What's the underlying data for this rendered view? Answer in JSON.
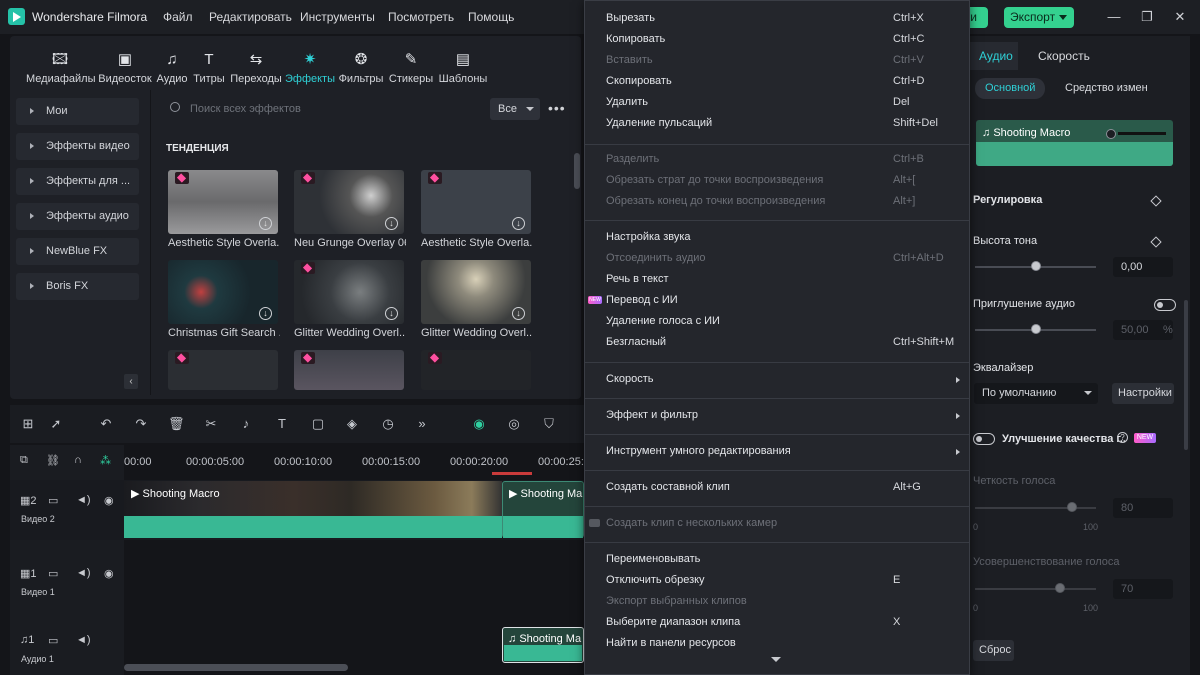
{
  "app": {
    "title": "Wondershare Filmora"
  },
  "menubar": [
    "Файл",
    "Редактировать",
    "Инструменты",
    "Посмотреть",
    "Помощь"
  ],
  "header": {
    "export_partial": "ити",
    "export_label": "Экспорт",
    "accent": "#34d18f"
  },
  "toolbar": [
    "Медиафайлы",
    "Видеосток",
    "Аудио",
    "Титры",
    "Переходы",
    "Эффекты",
    "Фильтры",
    "Стикеры",
    "Шаблоны"
  ],
  "categories": [
    "Мои",
    "Эффекты видео",
    "Эффекты для ...",
    "Эффекты аудио",
    "NewBlue FX",
    "Boris FX"
  ],
  "search": {
    "placeholder": "Поиск всех эффектов",
    "filter": "Все"
  },
  "section_title": "ТЕНДЕНЦИЯ",
  "effects": [
    {
      "label": "Aesthetic Style Overla..."
    },
    {
      "label": "Neu Grunge Overlay 06"
    },
    {
      "label": "Aesthetic Style Overla..."
    },
    {
      "label": "Christmas Gift Search ..."
    },
    {
      "label": "Glitter Wedding Overl..."
    },
    {
      "label": "Glitter Wedding Overl..."
    }
  ],
  "timeline": {
    "ruler": [
      "00:00",
      "00:00:05:00",
      "00:00:10:00",
      "00:00:15:00",
      "00:00:20:00",
      "00:00:25:0"
    ],
    "tracks": [
      {
        "num": "2",
        "name": "Видео 2"
      },
      {
        "num": "1",
        "name": "Видео 1"
      },
      {
        "num": "1",
        "name": "Аудио 1"
      }
    ],
    "clip_main": "Shooting Macro",
    "clip_second": "Shooting Ma",
    "clip_audio": "Shooting Ma"
  },
  "context_menu": [
    {
      "label": "Вырезать",
      "shortcut": "Ctrl+X"
    },
    {
      "label": "Копировать",
      "shortcut": "Ctrl+C"
    },
    {
      "label": "Вставить",
      "shortcut": "Ctrl+V",
      "disabled": true
    },
    {
      "label": "Скопировать",
      "shortcut": "Ctrl+D"
    },
    {
      "label": "Удалить",
      "shortcut": "Del"
    },
    {
      "label": "Удаление пульсаций",
      "shortcut": "Shift+Del"
    },
    {
      "label": "Разделить",
      "shortcut": "Ctrl+B",
      "disabled": true
    },
    {
      "label": "Обрезать страт до точки воспроизведения",
      "shortcut": "Alt+[",
      "disabled": true
    },
    {
      "label": "Обрезать конец до точки воспроизведения",
      "shortcut": "Alt+]",
      "disabled": true
    },
    {
      "label": "Настройка звука",
      "shortcut": ""
    },
    {
      "label": "Отсоединить аудио",
      "shortcut": "Ctrl+Alt+D",
      "disabled": true
    },
    {
      "label": "Речь в текст",
      "shortcut": ""
    },
    {
      "label": "Перевод с ИИ",
      "shortcut": "",
      "badge": "NEW"
    },
    {
      "label": "Удаление голоса с ИИ",
      "shortcut": ""
    },
    {
      "label": "Безгласный",
      "shortcut": "Ctrl+Shift+M"
    },
    {
      "label": "Скорость",
      "shortcut": "",
      "submenu": true
    },
    {
      "label": "Эффект и фильтр",
      "shortcut": "",
      "submenu": true
    },
    {
      "label": "Инструмент умного редактирования",
      "shortcut": "",
      "submenu": true
    },
    {
      "label": "Создать составной клип",
      "shortcut": "Alt+G"
    },
    {
      "label": "Создать клип с нескольких камер",
      "shortcut": "",
      "disabled": true
    },
    {
      "label": "Переименовывать",
      "shortcut": ""
    },
    {
      "label": "Отключить обрезку",
      "shortcut": "E"
    },
    {
      "label": "Экспорт выбранных клипов",
      "shortcut": "",
      "disabled": true
    },
    {
      "label": "Выберите диапазон клипа",
      "shortcut": "X"
    },
    {
      "label": "Найти в панели ресурсов",
      "shortcut": ""
    }
  ],
  "right_panel": {
    "tabs": [
      "Аудио",
      "Скорость"
    ],
    "subtabs": [
      "Основной",
      "Средство измен"
    ],
    "clip_name": "Shooting Macro",
    "adjust": "Регулировка",
    "pitch_label": "Высота тона",
    "pitch_value": "0,00",
    "pitch_level": 0.5,
    "ducking_label": "Приглушение аудио",
    "ducking_value": "50,00",
    "ducking_unit": "%",
    "ducking_level": 0.5,
    "eq_label": "Эквалайзер",
    "eq_value": "По умолчанию",
    "eq_settings": "Настройки",
    "enhance_label": "Улучшение качества г..",
    "enhance_badge": "NEW",
    "clarity_label": "Четкость голоса",
    "clarity_value": "80",
    "clarity_min": "0",
    "clarity_max": "100",
    "clarity_level": 0.8,
    "improve_label": "Усовершенствование голоса",
    "improve_value": "70",
    "improve_min": "0",
    "improve_max": "100",
    "improve_level": 0.7,
    "reset": "Сброс"
  }
}
